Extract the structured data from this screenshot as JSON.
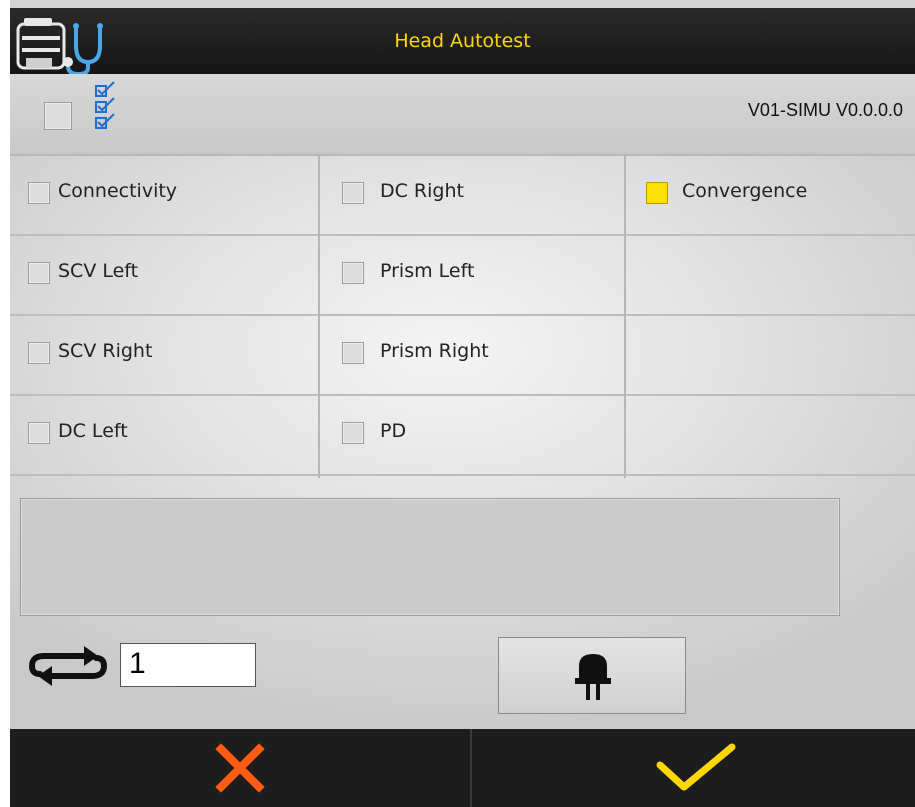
{
  "header": {
    "title": "Head Autotest",
    "app_icon": "head-stethoscope-icon"
  },
  "toolbar": {
    "select_all_checked": false,
    "checklist_icon": "checklist-icon",
    "version": "V01-SIMU V0.0.0.0"
  },
  "tests": {
    "col1": [
      {
        "label": "Connectivity",
        "state": "unchecked"
      },
      {
        "label": "SCV Left",
        "state": "unchecked"
      },
      {
        "label": "SCV Right",
        "state": "unchecked"
      },
      {
        "label": "DC Left",
        "state": "unchecked"
      }
    ],
    "col2": [
      {
        "label": "DC Right",
        "state": "unchecked"
      },
      {
        "label": "Prism Left",
        "state": "unchecked"
      },
      {
        "label": "Prism Right",
        "state": "unchecked"
      },
      {
        "label": "PD",
        "state": "unchecked"
      }
    ],
    "col3": [
      {
        "label": "Convergence",
        "state": "yellow"
      }
    ]
  },
  "message": "",
  "loop": {
    "icon": "repeat-icon",
    "count": "1"
  },
  "led_button": {
    "icon": "led-icon"
  },
  "footer": {
    "cancel_icon": "close-icon",
    "ok_icon": "checkmark-icon"
  },
  "colors": {
    "accent": "#ffd800",
    "cancel": "#ff5a14",
    "ok": "#ffd800",
    "header_bg": "#1e1e1e",
    "pending": "#ffe000"
  }
}
